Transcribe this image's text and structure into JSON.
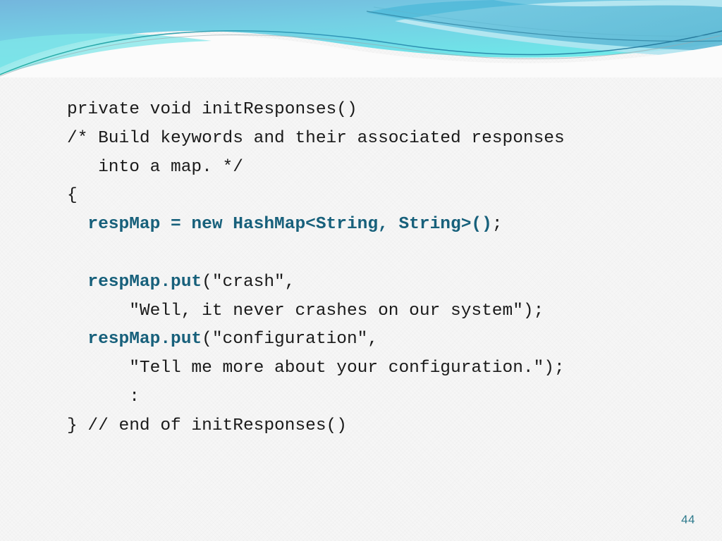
{
  "slide": {
    "number": "44",
    "number_color": "#2e7a8c",
    "background_color": "#f6f6f6",
    "accent_color": "#17607b",
    "banner": {
      "name": "decorative-wave-banner",
      "colors": [
        "#6fb8dc",
        "#6fe4e8",
        "#3fb9d6",
        "#9fe0ee",
        "#1f8fb0",
        "#18a89a"
      ]
    }
  },
  "code": {
    "language": "java",
    "lines": [
      {
        "id": "line-1",
        "spans": [
          {
            "text": "private void initResponses()",
            "style": "plain"
          }
        ]
      },
      {
        "id": "line-2",
        "spans": [
          {
            "text": "/* Build keywords and their associated responses",
            "style": "plain"
          }
        ]
      },
      {
        "id": "line-3",
        "spans": [
          {
            "text": "   into a map. */",
            "style": "plain"
          }
        ]
      },
      {
        "id": "line-4",
        "spans": [
          {
            "text": "{",
            "style": "plain"
          }
        ]
      },
      {
        "id": "line-5",
        "spans": [
          {
            "text": "  ",
            "style": "plain"
          },
          {
            "text": "respMap = new HashMap<String, String>()",
            "style": "keyword"
          },
          {
            "text": ";",
            "style": "plain"
          }
        ]
      },
      {
        "id": "line-6",
        "spans": [
          {
            "text": "",
            "style": "plain"
          }
        ]
      },
      {
        "id": "line-7",
        "spans": [
          {
            "text": "  ",
            "style": "plain"
          },
          {
            "text": "respMap.put",
            "style": "keyword"
          },
          {
            "text": "(\"crash\",",
            "style": "plain"
          }
        ]
      },
      {
        "id": "line-8",
        "spans": [
          {
            "text": "      \"Well, it never crashes on our system\");",
            "style": "plain"
          }
        ]
      },
      {
        "id": "line-9",
        "spans": [
          {
            "text": "  ",
            "style": "plain"
          },
          {
            "text": "respMap.put",
            "style": "keyword"
          },
          {
            "text": "(\"configuration\",",
            "style": "plain"
          }
        ]
      },
      {
        "id": "line-10",
        "spans": [
          {
            "text": "      \"Tell me more about your configuration.\");",
            "style": "plain"
          }
        ]
      },
      {
        "id": "line-11",
        "spans": [
          {
            "text": "      :",
            "style": "plain"
          }
        ]
      },
      {
        "id": "line-12",
        "spans": [
          {
            "text": "} // end of initResponses()",
            "style": "plain"
          }
        ]
      }
    ]
  }
}
